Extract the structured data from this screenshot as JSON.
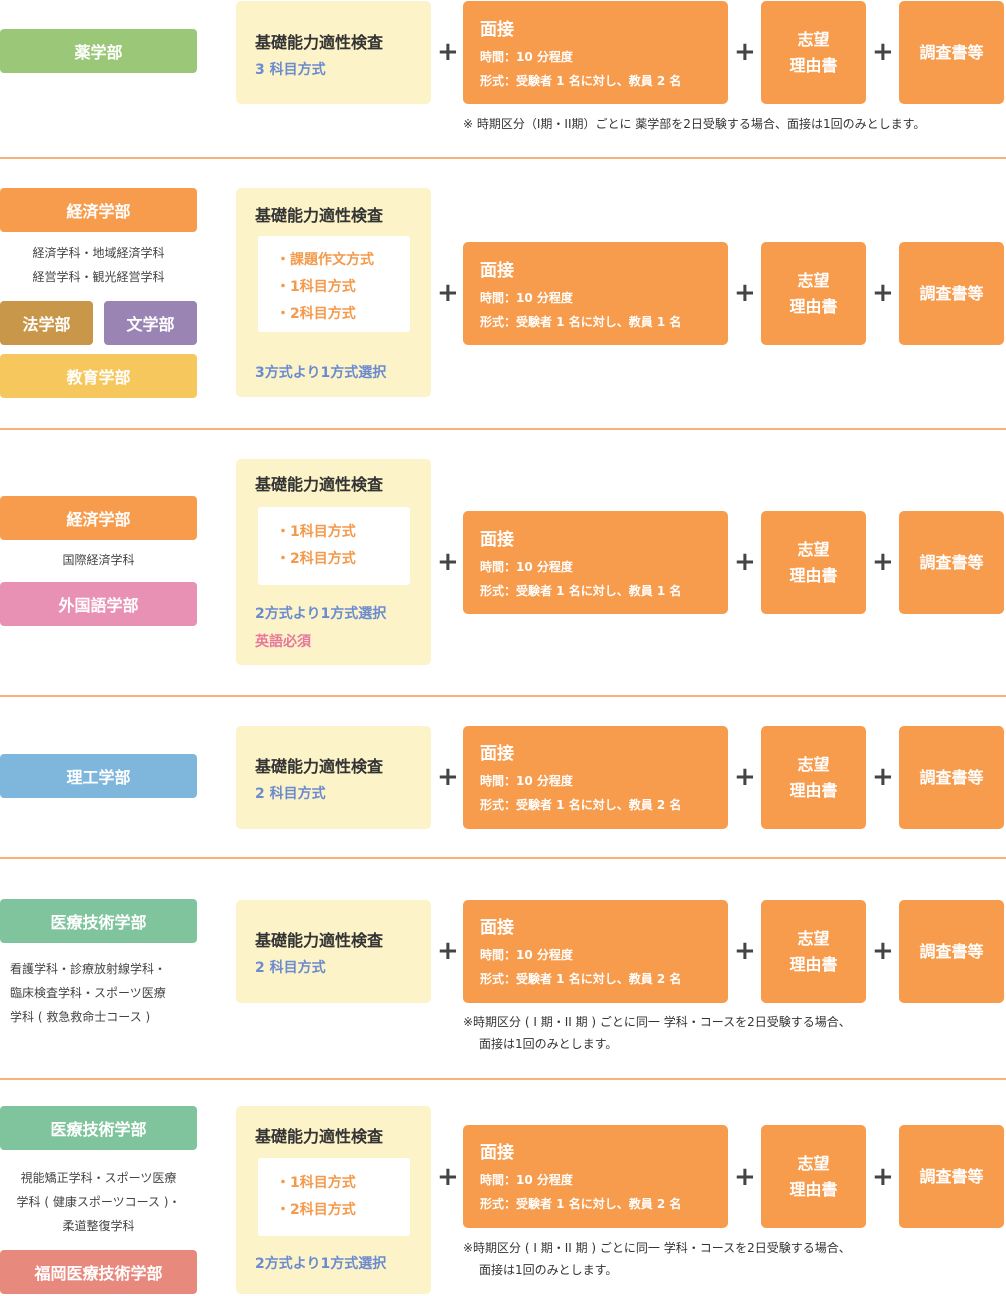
{
  "common": {
    "test_title": "基礎能力適性検査",
    "interview_title": "面接",
    "interview_time": "時間：10 分程度",
    "reason_line1": "志望",
    "reason_line2": "理由書",
    "docs": "調査書等",
    "plus": "+"
  },
  "colors": {
    "orange": "#f79b4c",
    "green": "#9bc878",
    "tan": "#c8974a",
    "purple": "#9a84b4",
    "yellow": "#f5c75c",
    "pink": "#e891b4",
    "blue": "#7fb6dc",
    "teal": "#80c49d",
    "salmon": "#e8897e",
    "test_bg": "#fcf3c8",
    "method_blue": "#6b8bd0"
  },
  "sections": [
    {
      "faculty": "薬学部",
      "test_method": "3 科目方式",
      "interview_format": "形式：受験者 1 名に対し、教員 2 名",
      "note_lines": [
        "※ 時期区分（I期・II期）ごとに 薬学部を2日受験する場合、面接は1回のみとします。"
      ]
    },
    {
      "faculty": "経済学部",
      "departments": [
        "経済学科・地域経済学科",
        "経営学科・観光経営学科"
      ],
      "faculty_law": "法学部",
      "faculty_letters": "文学部",
      "faculty_edu": "教育学部",
      "options": [
        "・課題作文方式",
        "・1科目方式",
        "・2科目方式"
      ],
      "selection": "3方式より1方式選択",
      "interview_format": "形式：受験者 1 名に対し、教員 1 名"
    },
    {
      "faculty": "経済学部",
      "departments": [
        "国際経済学科"
      ],
      "faculty2": "外国語学部",
      "options": [
        "・1科目方式",
        "・2科目方式"
      ],
      "selection": "2方式より1方式選択",
      "selection_note": "英語必須",
      "interview_format": "形式：受験者 1 名に対し、教員 1 名"
    },
    {
      "faculty": "理工学部",
      "test_method": "2 科目方式",
      "interview_format": "形式：受験者 1 名に対し、教員 2 名"
    },
    {
      "faculty": "医療技術学部",
      "departments": [
        "看護学科・診療放射線学科・",
        "臨床検査学科・スポーツ医療",
        "学科 ( 救急救命士コース )"
      ],
      "test_method": "2 科目方式",
      "interview_format": "形式：受験者 1 名に対し、教員 2 名",
      "note_lines": [
        "※時期区分 ( I 期・II 期 ) ごとに同一 学科・コースを2日受験する場合、",
        "面接は1回のみとします。"
      ]
    },
    {
      "faculty": "医療技術学部",
      "departments": [
        "視能矯正学科・スポーツ医療",
        "学科 ( 健康スポーツコース )・",
        "柔道整復学科"
      ],
      "faculty2": "福岡医療技術学部",
      "options": [
        "・1科目方式",
        "・2科目方式"
      ],
      "selection": "2方式より1方式選択",
      "interview_format": "形式：受験者 1 名に対し、教員 2 名",
      "note_lines": [
        "※時期区分 ( I 期・II 期 ) ごとに同一 学科・コースを2日受験する場合、",
        "面接は1回のみとします。"
      ]
    }
  ]
}
